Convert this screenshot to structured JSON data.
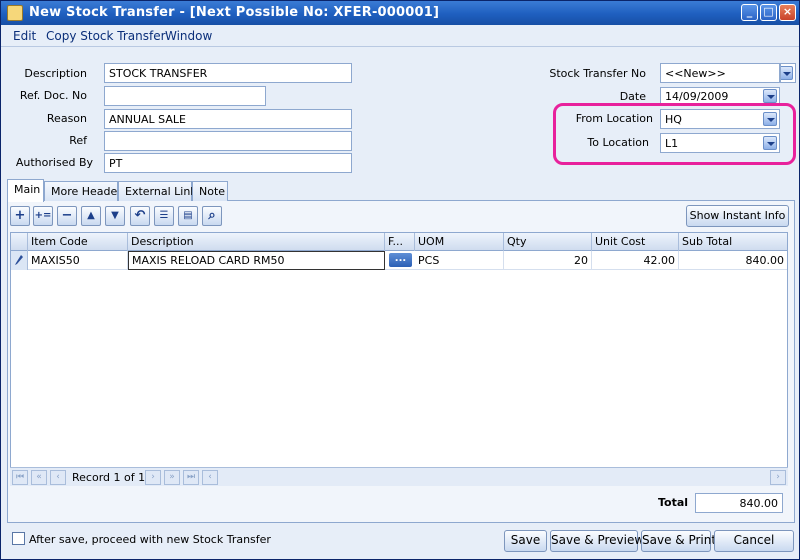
{
  "window": {
    "title": "New Stock Transfer - [Next Possible No: XFER-000001]"
  },
  "menu": [
    "Edit",
    "Copy Stock Transfer",
    "Window"
  ],
  "header": {
    "description_label": "Description",
    "description_value": "STOCK TRANSFER",
    "ref_doc_no_label": "Ref. Doc. No",
    "ref_doc_no_value": "",
    "reason_label": "Reason",
    "reason_value": "ANNUAL SALE",
    "ref_label": "Ref",
    "ref_value": "",
    "authorised_by_label": "Authorised By",
    "authorised_by_value": "PT",
    "stock_transfer_no_label": "Stock Transfer No",
    "stock_transfer_no_value": "<<New>>",
    "date_label": "Date",
    "date_value": "14/09/2009",
    "from_location_label": "From Location",
    "from_location_value": "HQ",
    "to_location_label": "To Location",
    "to_location_value": "L1"
  },
  "tabs": [
    "Main",
    "More Header",
    "External Link",
    "Note"
  ],
  "toolbar": {
    "icons": [
      "add-icon",
      "insert-icon",
      "remove-icon",
      "move-up-icon",
      "move-down-icon",
      "undo-icon",
      "list-icon",
      "detail-icon",
      "search-icon"
    ],
    "show_instant_info": "Show Instant Info"
  },
  "grid": {
    "columns": [
      "Item Code",
      "Description",
      "F...",
      "UOM",
      "Qty",
      "Unit Cost",
      "Sub Total"
    ],
    "rows": [
      {
        "item_code": "MAXIS50",
        "description": "MAXIS RELOAD CARD RM50",
        "f": "...",
        "uom": "PCS",
        "qty": "20",
        "unit_cost": "42.00",
        "sub_total": "840.00"
      }
    ],
    "record_text": "Record 1 of 1"
  },
  "totals": {
    "label": "Total",
    "value": "840.00"
  },
  "footer": {
    "proceed_label": "After save, proceed with new Stock Transfer",
    "proceed_checked": false,
    "save": "Save",
    "save_preview": "Save & Preview",
    "save_print": "Save & Print",
    "cancel": "Cancel"
  },
  "colors": {
    "title_bar": "#1f5fbf",
    "highlight": "#e8219c"
  }
}
